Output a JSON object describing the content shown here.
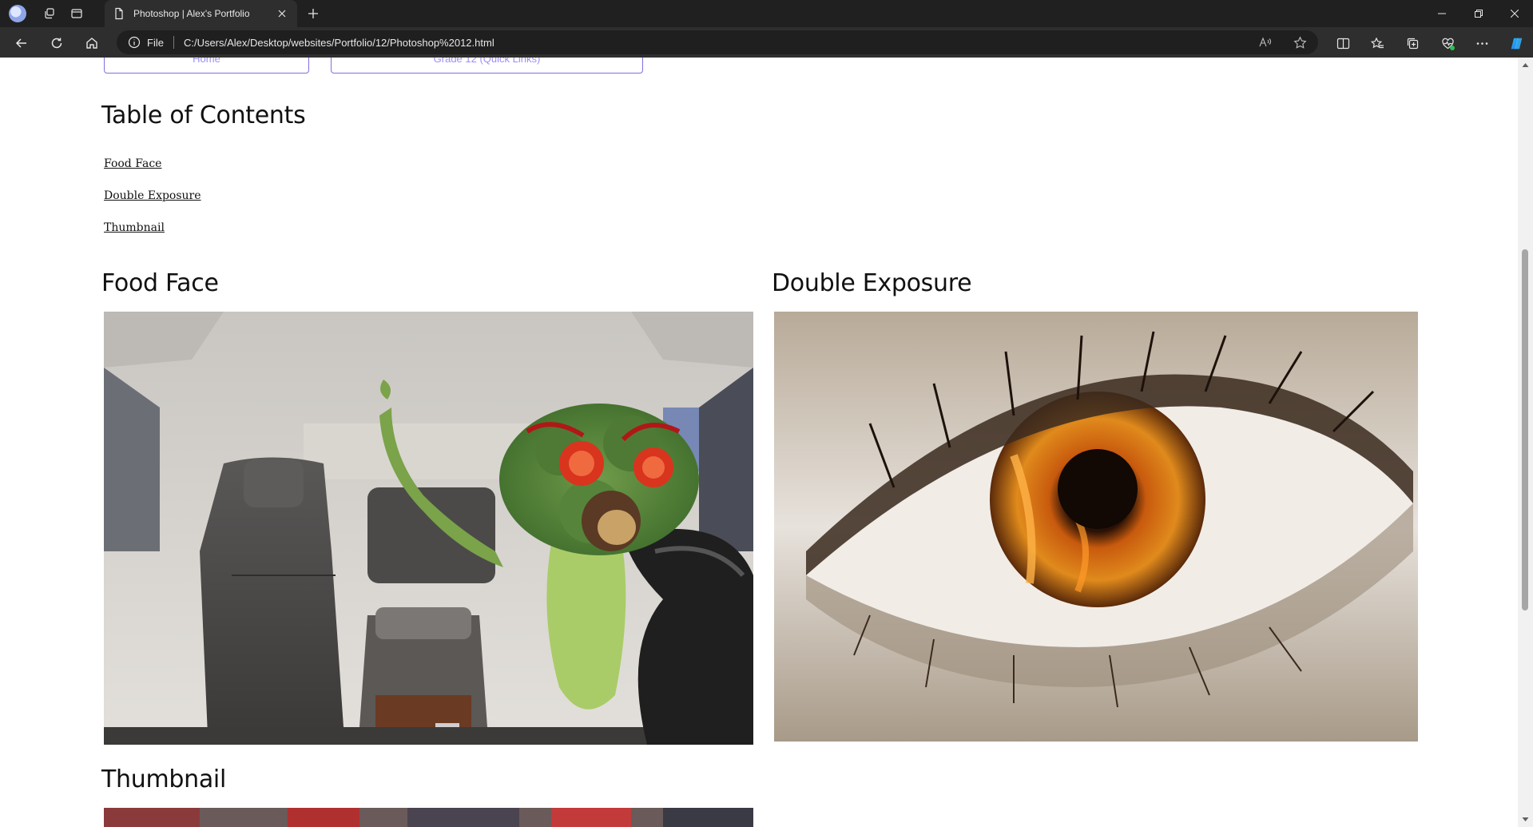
{
  "browser": {
    "tab": {
      "title": "Photoshop | Alex's Portfolio"
    },
    "address": {
      "scheme": "File",
      "url": "C:/Users/Alex/Desktop/websites/Portfolio/12/Photoshop%2012.html"
    },
    "icons": {
      "profile": "profile-avatar",
      "workspaces": "workspaces-icon",
      "tab_actions": "tab-actions-icon",
      "back": "back-arrow-icon",
      "refresh": "refresh-icon",
      "home": "home-icon",
      "read_aloud": "read-aloud-icon",
      "favorite": "star-icon",
      "split": "split-screen-icon",
      "favorites": "favorites-icon",
      "collections": "collections-icon",
      "performance": "heart-pulse-icon",
      "more": "more-icon",
      "copilot": "copilot-icon"
    }
  },
  "page": {
    "nav": {
      "home_label": "Home",
      "grade_label": "Grade 12 (Quick Links)"
    },
    "toc": {
      "heading": "Table of Contents",
      "links": [
        "Food Face",
        "Double Exposure",
        "Thumbnail"
      ]
    },
    "sections": {
      "food_face": {
        "heading": "Food Face"
      },
      "double_exposure": {
        "heading": "Double Exposure"
      },
      "thumbnail": {
        "heading": "Thumbnail"
      }
    }
  },
  "colors": {
    "link_box_border": "#8070e0",
    "link_box_text": "#9a8ff0",
    "chrome_dark": "#202020",
    "chrome_toolbar": "#2e2e2e"
  }
}
